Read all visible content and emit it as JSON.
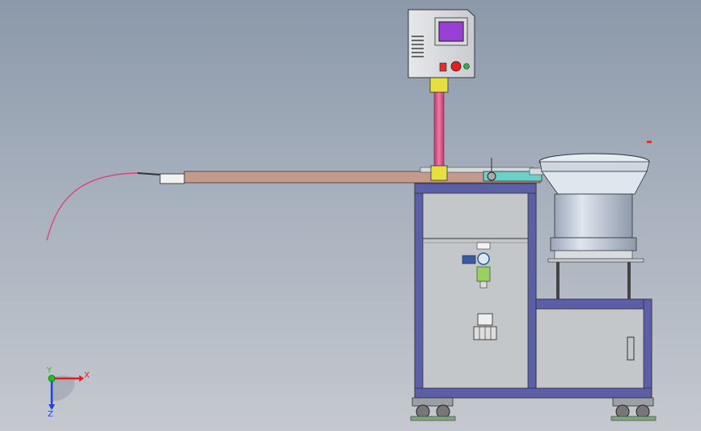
{
  "scene": "cad-3d-viewport",
  "colors": {
    "background_top": "#8b99aa",
    "background_bottom": "#c5c9cf",
    "frame": "#5a5fa8",
    "panel": "#c4c7ca",
    "pillar": "#e05a8a",
    "hmi_screen": "#9a3fd6",
    "bowl": "#b8c4d4",
    "wire": "#d9477a",
    "axis_x": "#e02020",
    "axis_y": "#20c020",
    "axis_z": "#2040e0"
  },
  "axis_triad": {
    "x_label": "X",
    "y_label": "Y",
    "z_label": "Z"
  }
}
